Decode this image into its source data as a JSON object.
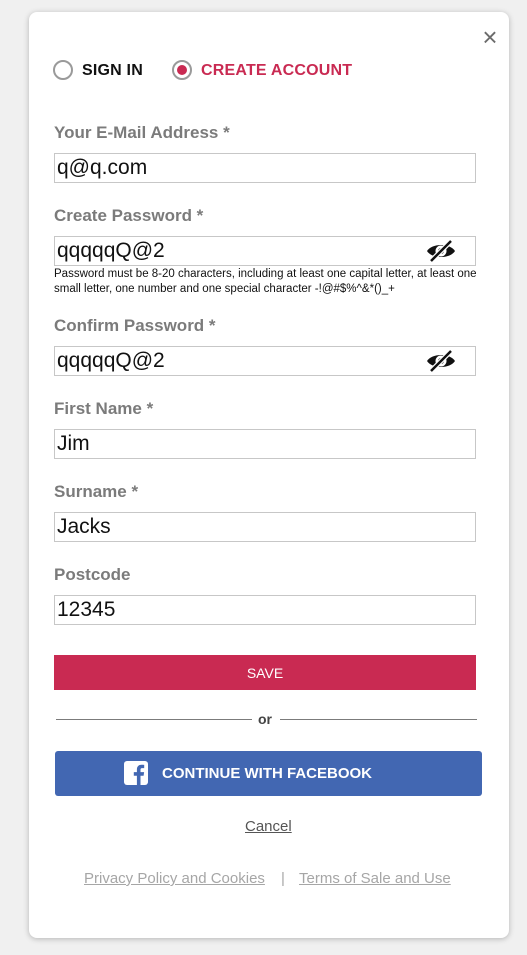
{
  "dialog": {
    "close_symbol": "×",
    "close_icon": "close-icon"
  },
  "mode": {
    "options": [
      {
        "label": "SIGN IN",
        "selected": false
      },
      {
        "label": "CREATE ACCOUNT",
        "selected": true
      }
    ],
    "accent_color": "#c92a52"
  },
  "form": {
    "email": {
      "label": "Your E-Mail Address *",
      "value": "q@q.com"
    },
    "password": {
      "label": "Create Password *",
      "value": "qqqqqQ@2",
      "toggle_icon": "eye-slash-icon",
      "hint": "Password must be 8-20 characters, including at least one capital letter, at least one small letter, one number and one special character -!@#$%^&*()_+"
    },
    "confirm_password": {
      "label": "Confirm Password *",
      "value": "qqqqqQ@2",
      "toggle_icon": "eye-slash-icon"
    },
    "first_name": {
      "label": "First Name *",
      "value": "Jim"
    },
    "surname": {
      "label": "Surname *",
      "value": "Jacks"
    },
    "postcode": {
      "label": "Postcode",
      "value": "12345"
    }
  },
  "actions": {
    "save_label": "SAVE",
    "or_label": "or",
    "facebook_label": "CONTINUE WITH FACEBOOK",
    "facebook_icon": "facebook-icon",
    "facebook_color": "#4267b2",
    "cancel_label": "Cancel"
  },
  "footer": {
    "privacy_label": "Privacy Policy and Cookies",
    "separator": "|",
    "terms_label": "Terms of Sale and Use"
  }
}
